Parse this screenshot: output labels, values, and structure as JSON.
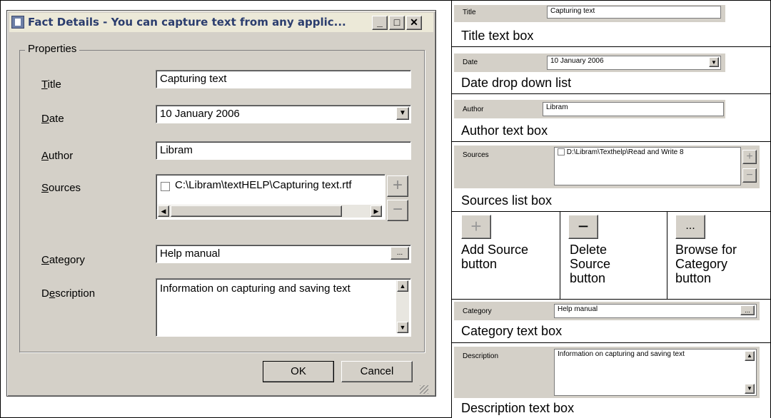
{
  "dialog": {
    "title": "Fact Details - You can capture text from any applic...",
    "window_buttons": [
      "_",
      "□",
      "✕"
    ],
    "group_label": "Properties",
    "fields": {
      "title": {
        "label_u": "T",
        "label_rest": "itle",
        "value": "Capturing text"
      },
      "date": {
        "label_u": "D",
        "label_rest": "ate",
        "value": "10  January  2006"
      },
      "author": {
        "label_u": "A",
        "label_rest": "uthor",
        "value": "Libram"
      },
      "sources": {
        "label_u": "S",
        "label_rest": "ources",
        "value": "C:\\Libram\\textHELP\\Capturing text.rtf"
      },
      "category": {
        "label_u": "C",
        "label_rest": "ategory",
        "value": "Help manual",
        "browse": "..."
      },
      "description": {
        "label_pre": "D",
        "label_u": "e",
        "label_rest": "scription",
        "value": "Information on capturing and saving text"
      }
    },
    "ok_label": "OK",
    "cancel_label": "Cancel"
  },
  "legend": {
    "title": {
      "label": "Title",
      "value": "Capturing text",
      "caption": "Title text box"
    },
    "date": {
      "label": "Date",
      "value": "10  January  2006",
      "caption": "Date drop down list"
    },
    "author": {
      "label": "Author",
      "value": "Libram",
      "caption": "Author text box"
    },
    "sources": {
      "label": "Sources",
      "value": "D:\\Libram\\Texthelp\\Read and Write 8",
      "caption": "Sources list box"
    },
    "buttons": {
      "add": {
        "caption1": "Add Source",
        "caption2": "button"
      },
      "delete": {
        "caption1": "Delete",
        "caption2": "Source",
        "caption3": "button"
      },
      "browse": {
        "label": "...",
        "caption1": "Browse for",
        "caption2": "Category",
        "caption3": "button"
      }
    },
    "category": {
      "label": "Category",
      "value": "Help manual",
      "browse": "...",
      "caption": "Category text box"
    },
    "description": {
      "label": "Description",
      "value": "Information on capturing and saving text",
      "caption": "Description text box"
    }
  }
}
